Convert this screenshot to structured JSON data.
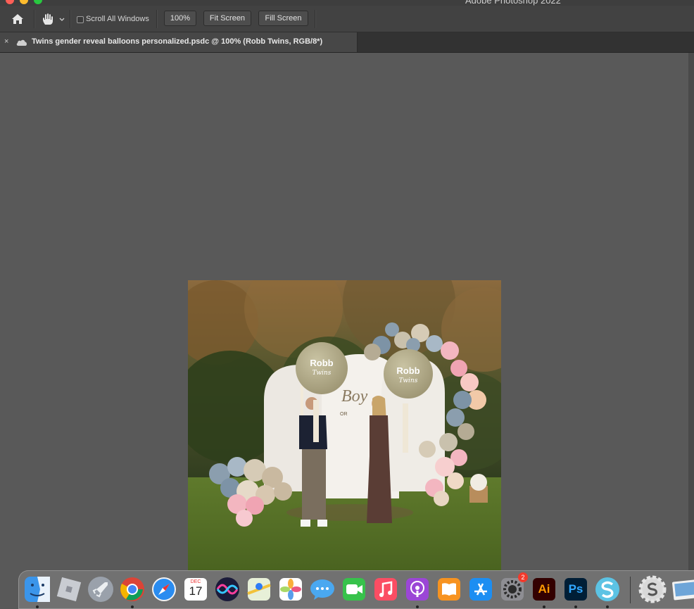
{
  "window": {
    "app_title": "Adobe Photoshop 2022"
  },
  "options_bar": {
    "scroll_all_label": "Scroll All Windows",
    "zoom_100_label": "100%",
    "fit_screen_label": "Fit Screen",
    "fill_screen_label": "Fill Screen"
  },
  "document_tab": {
    "close_glyph": "×",
    "title": "Twins gender reveal balloons personalized.psdc @ 100% (Robb  Twins, RGB/8*)"
  },
  "image": {
    "balloon_left_line1": "Robb",
    "balloon_left_line2": "Twins",
    "balloon_right_line1": "Robb",
    "balloon_right_line2": "Twins",
    "sign_text": "Boy",
    "sign_or": "OR"
  },
  "dock": {
    "apps": [
      "finder",
      "roblox",
      "launchpad",
      "chrome",
      "safari",
      "calendar",
      "siri",
      "maps",
      "photos",
      "messages",
      "facetime",
      "music",
      "podcasts",
      "books",
      "app-store",
      "system-preferences",
      "illustrator",
      "photoshop",
      "sketchup",
      "settings-alt",
      "preview"
    ],
    "calendar_month": "DEC",
    "calendar_day": "17",
    "system_prefs_badge": "2",
    "illustrator_label": "Ai",
    "photoshop_label": "Ps"
  },
  "colors": {
    "canvas_bg": "#595959",
    "options_bg": "#424242",
    "illustrator_bg": "#330000",
    "illustrator_fg": "#ff9a00",
    "photoshop_bg": "#001e36",
    "photoshop_fg": "#31a8ff"
  }
}
